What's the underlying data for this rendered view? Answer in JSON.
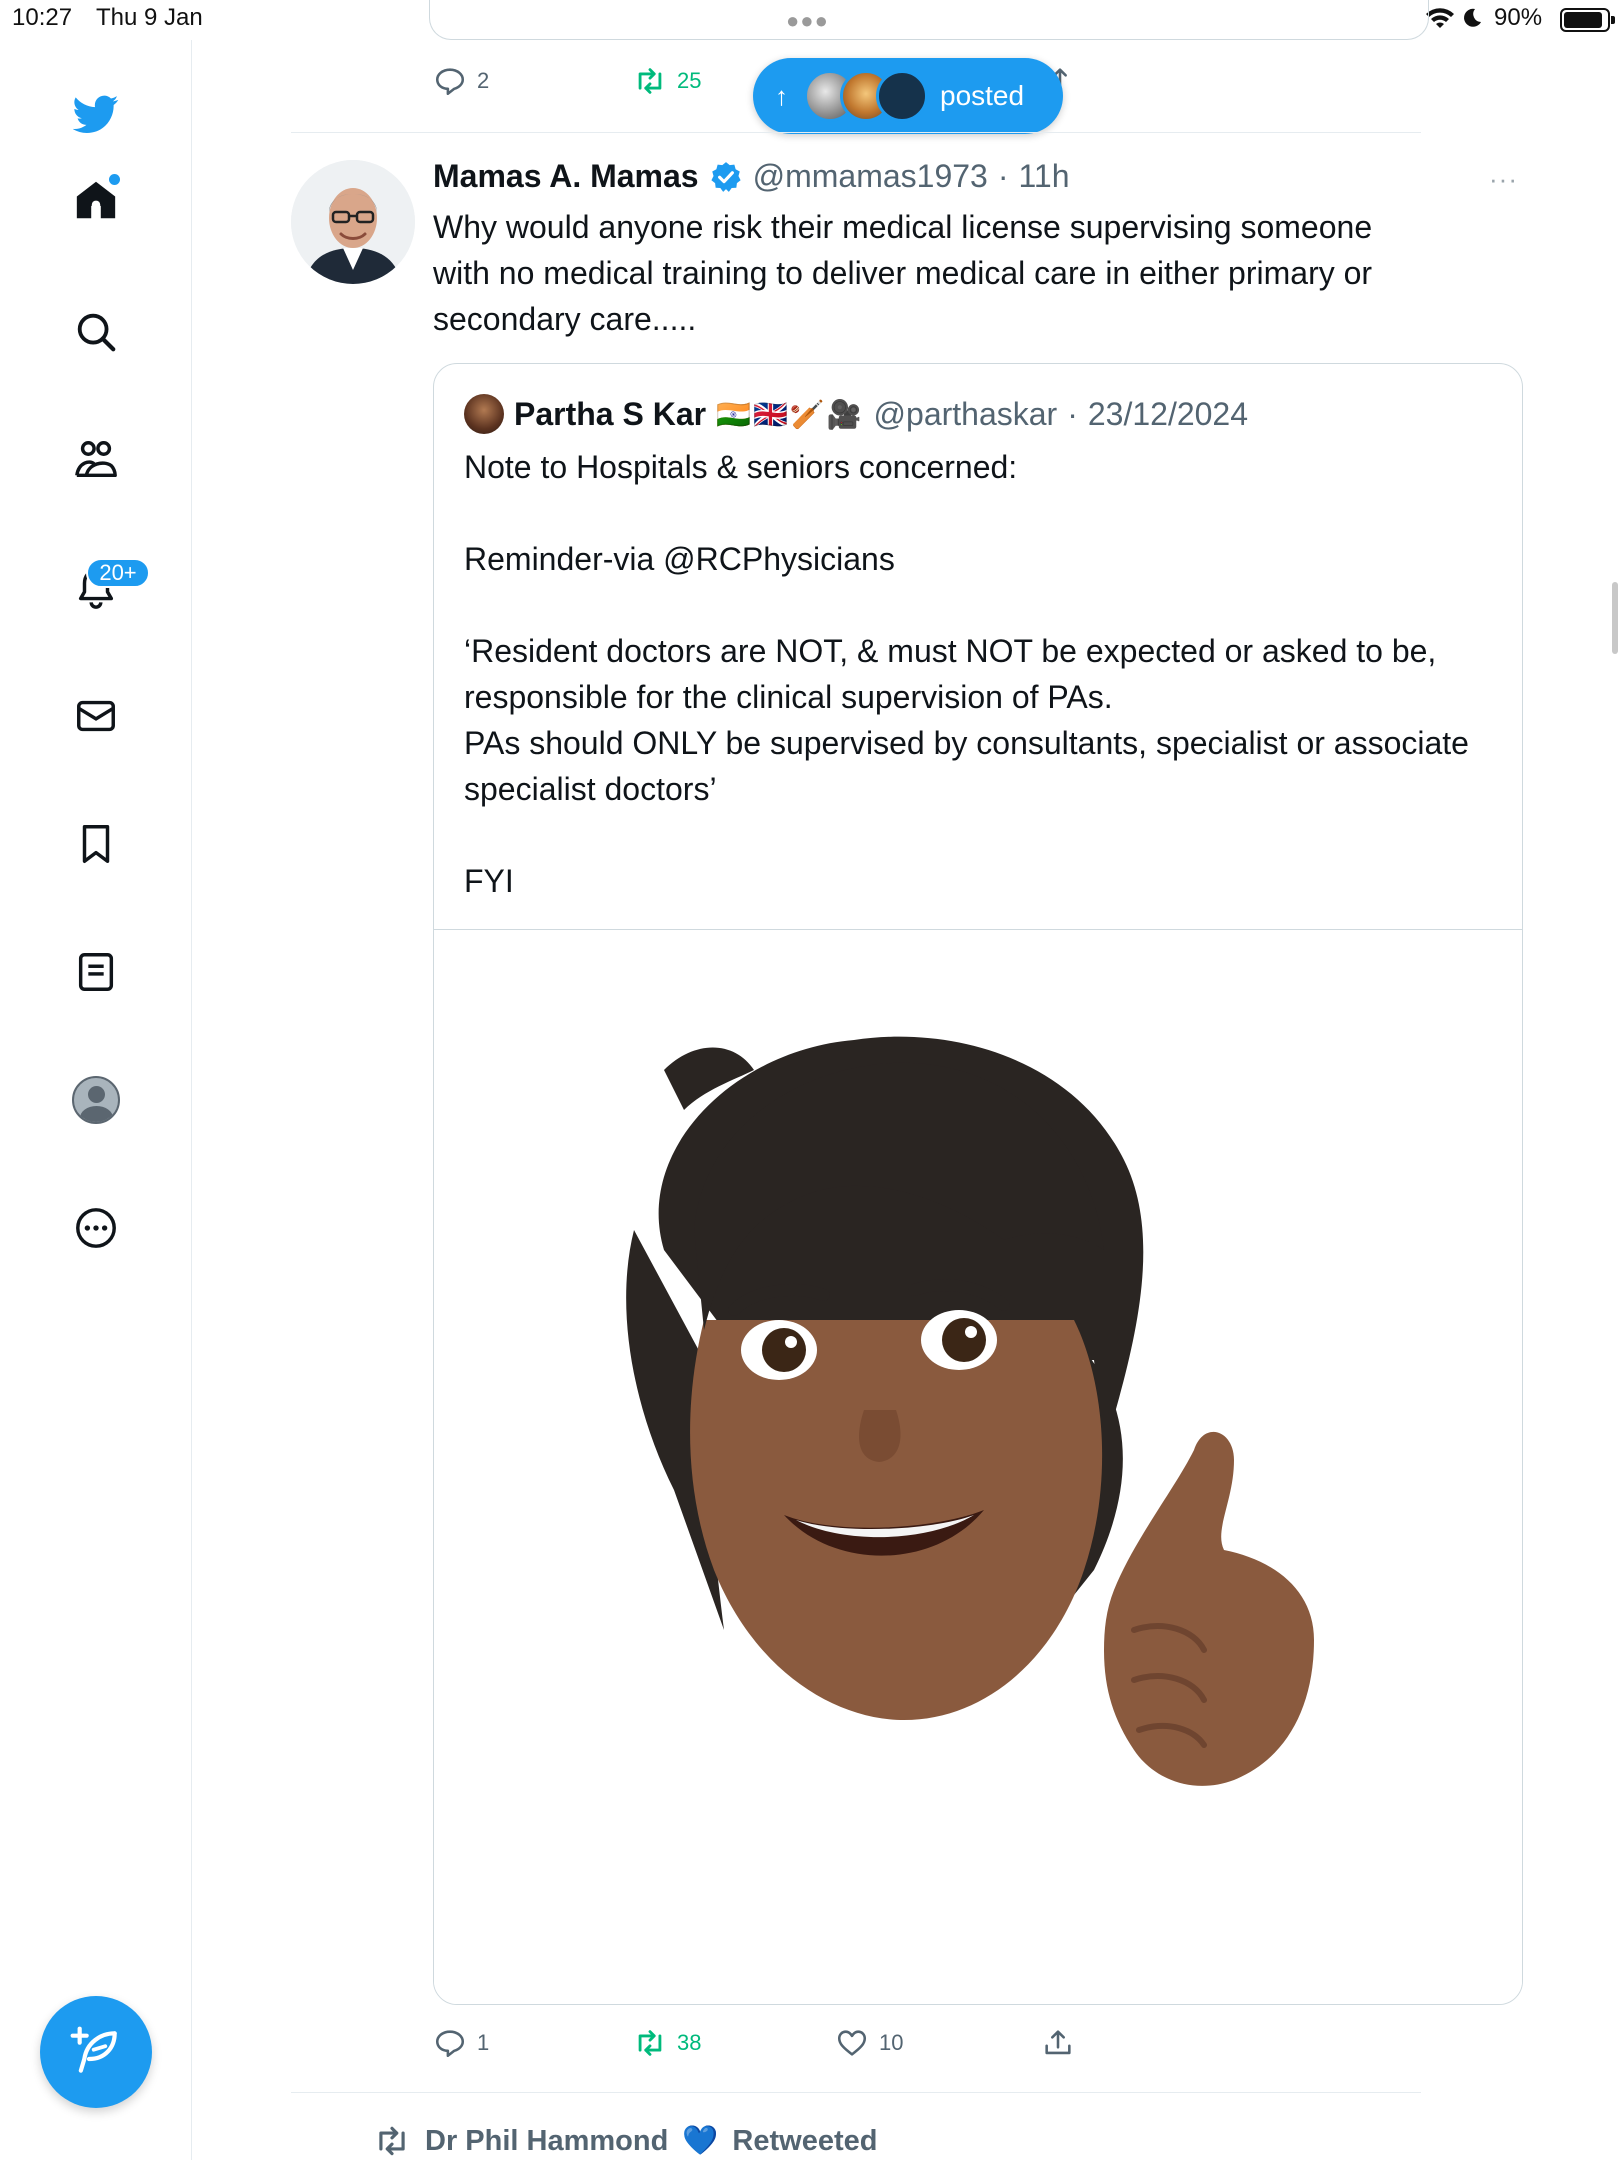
{
  "status_bar": {
    "time": "10:27",
    "date": "Thu 9 Jan",
    "battery": "90%",
    "battery_level": 0.9
  },
  "sidebar": {
    "items": [
      {
        "name": "home",
        "icon": "home-icon"
      },
      {
        "name": "explore",
        "icon": "search-icon"
      },
      {
        "name": "communities",
        "icon": "communities-icon"
      },
      {
        "name": "notifications",
        "icon": "bell-icon",
        "badge": "20+"
      },
      {
        "name": "messages",
        "icon": "mail-icon"
      },
      {
        "name": "bookmarks",
        "icon": "bookmark-icon"
      },
      {
        "name": "lists",
        "icon": "list-icon"
      },
      {
        "name": "profile",
        "icon": "avatar"
      },
      {
        "name": "more",
        "icon": "more-circle-icon"
      }
    ],
    "compose_icon": "feather-plus-icon"
  },
  "previous_tweet": {
    "reply_count": "2",
    "retweet_count": "25"
  },
  "posted_pill": {
    "label": "posted",
    "arrow": "↑"
  },
  "tweet": {
    "display_name": "Mamas A. Mamas",
    "handle": "@mmamas1973",
    "separator": "·",
    "time": "11h",
    "more": "···",
    "text": "Why would anyone risk their medical license supervising someone with no medical training to deliver medical care in either primary or secondary care.....",
    "quote": {
      "display_name": "Partha S Kar",
      "emojis": "🇮🇳🇬🇧🏏🎥",
      "handle": "@parthaskar",
      "separator": "·",
      "date": "23/12/2024",
      "text": "Note to Hospitals & seniors concerned:\n\nReminder-via @RCPhysicians\n\n‘Resident doctors are NOT, & must NOT be expected or asked to be, responsible for the clinical supervision of PAs.\nPAs should ONLY be supervised by consultants, specialist or associate specialist doctors’\n\nFYI",
      "media": "memoji-thumbs-up-image"
    },
    "reply_count": "1",
    "retweet_count": "38",
    "like_count": "10"
  },
  "next_item": {
    "retweeter": "Dr Phil Hammond",
    "heart": "💙",
    "label": "Retweeted"
  },
  "colors": {
    "accent": "#1d9bf0",
    "retweet_green": "#00ba7c",
    "secondary_text": "#536471",
    "border": "#cfd9de"
  }
}
